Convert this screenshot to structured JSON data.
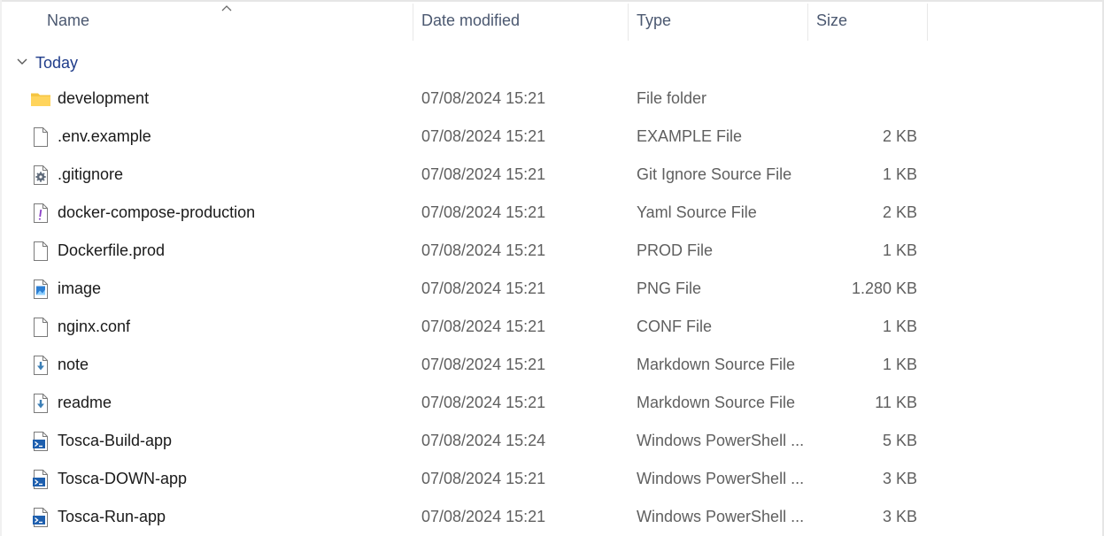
{
  "columns": {
    "name": "Name",
    "date_modified": "Date modified",
    "type": "Type",
    "size": "Size"
  },
  "group": {
    "label": "Today"
  },
  "files": [
    {
      "name": "development",
      "date": "07/08/2024 15:21",
      "type": "File folder",
      "size": "",
      "icon": "folder-icon"
    },
    {
      "name": ".env.example",
      "date": "07/08/2024 15:21",
      "type": "EXAMPLE File",
      "size": "2 KB",
      "icon": "file-icon"
    },
    {
      "name": ".gitignore",
      "date": "07/08/2024 15:21",
      "type": "Git Ignore Source File",
      "size": "1 KB",
      "icon": "settings-file-icon"
    },
    {
      "name": "docker-compose-production",
      "date": "07/08/2024 15:21",
      "type": "Yaml Source File",
      "size": "2 KB",
      "icon": "yaml-file-icon"
    },
    {
      "name": "Dockerfile.prod",
      "date": "07/08/2024 15:21",
      "type": "PROD File",
      "size": "1 KB",
      "icon": "file-icon"
    },
    {
      "name": "image",
      "date": "07/08/2024 15:21",
      "type": "PNG File",
      "size": "1.280 KB",
      "icon": "image-file-icon"
    },
    {
      "name": "nginx.conf",
      "date": "07/08/2024 15:21",
      "type": "CONF File",
      "size": "1 KB",
      "icon": "file-icon"
    },
    {
      "name": "note",
      "date": "07/08/2024 15:21",
      "type": "Markdown Source File",
      "size": "1 KB",
      "icon": "markdown-file-icon"
    },
    {
      "name": "readme",
      "date": "07/08/2024 15:21",
      "type": "Markdown Source File",
      "size": "11 KB",
      "icon": "markdown-file-icon"
    },
    {
      "name": "Tosca-Build-app",
      "date": "07/08/2024 15:24",
      "type": "Windows PowerShell ...",
      "size": "5 KB",
      "icon": "powershell-file-icon"
    },
    {
      "name": "Tosca-DOWN-app",
      "date": "07/08/2024 15:21",
      "type": "Windows PowerShell ...",
      "size": "3 KB",
      "icon": "powershell-file-icon"
    },
    {
      "name": "Tosca-Run-app",
      "date": "07/08/2024 15:21",
      "type": "Windows PowerShell ...",
      "size": "3 KB",
      "icon": "powershell-file-icon"
    }
  ]
}
